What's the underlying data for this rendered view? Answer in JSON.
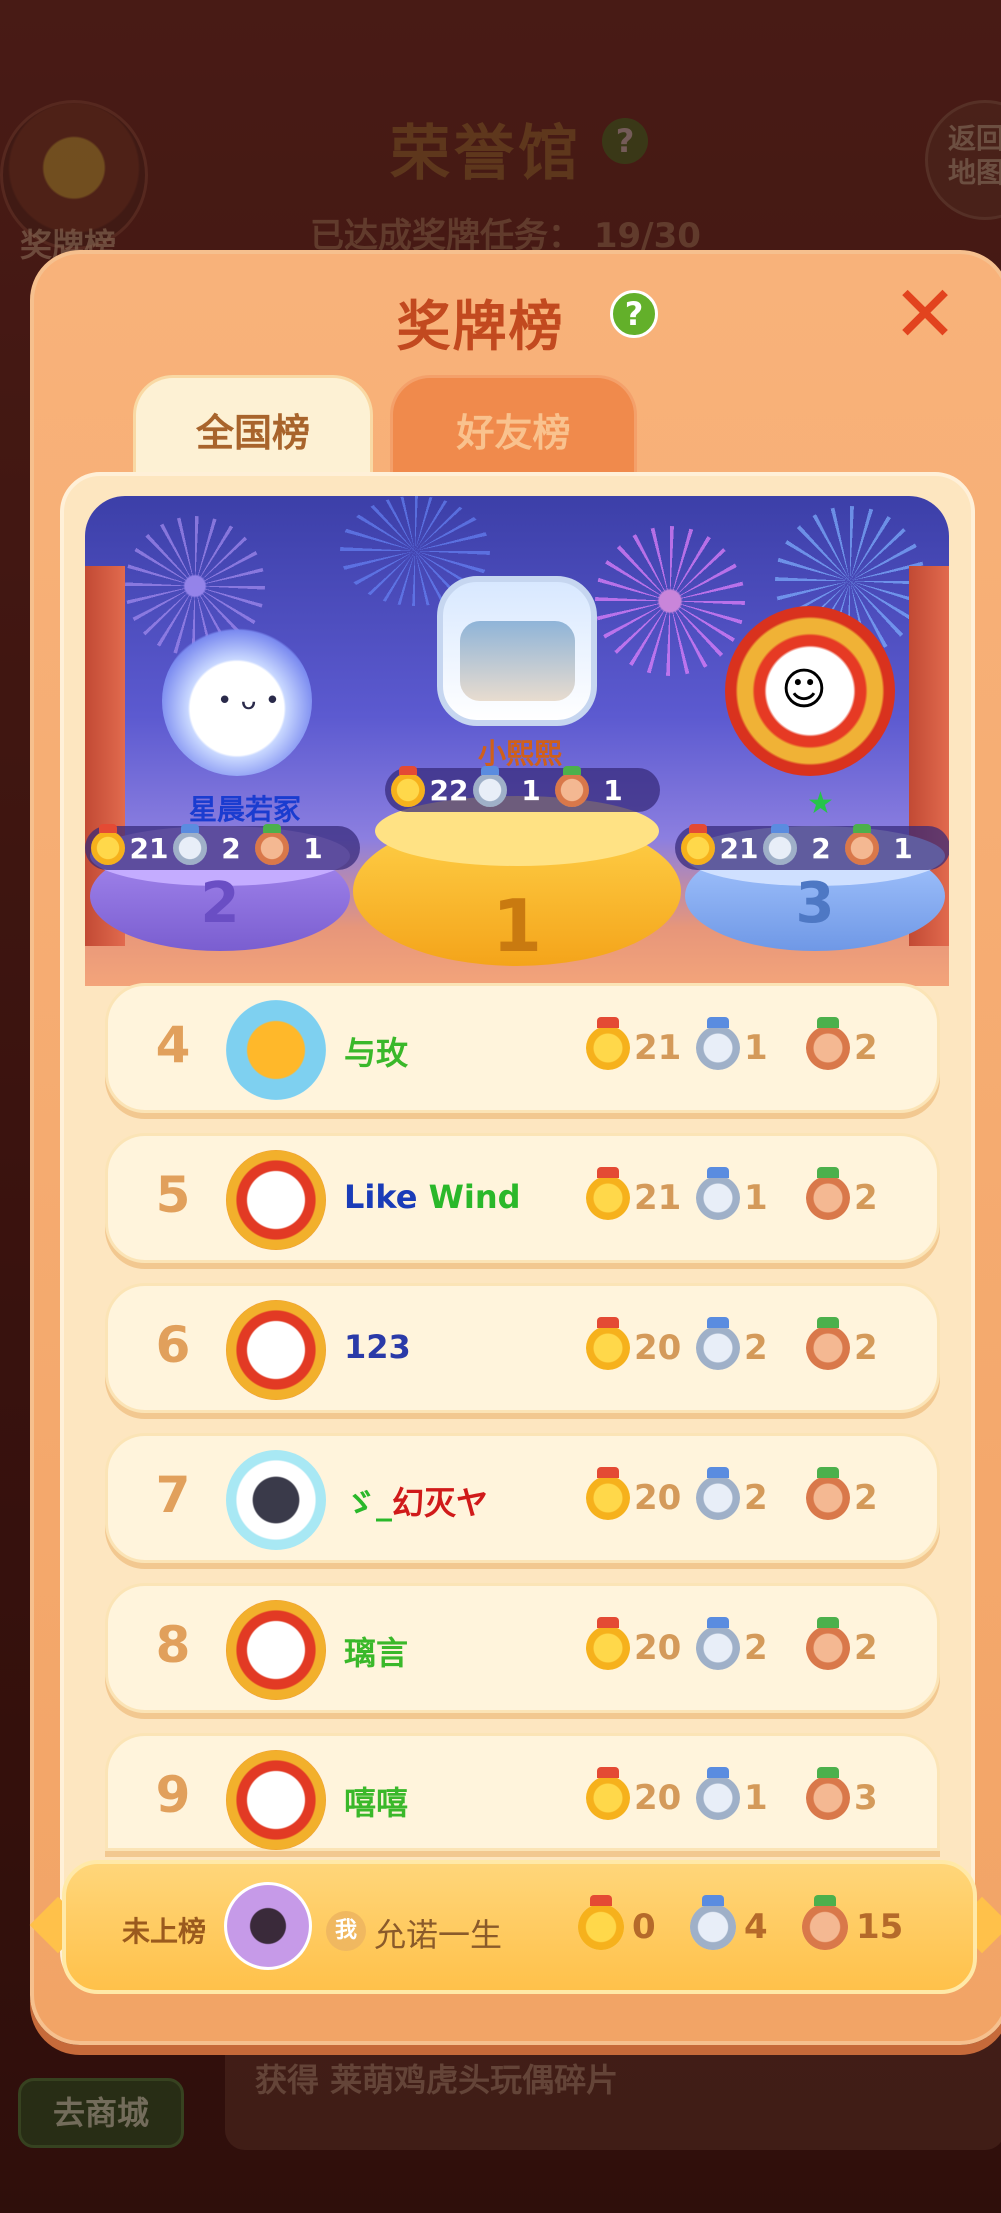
{
  "background": {
    "medal_board_label": "奖牌榜",
    "hall_title": "荣誉馆",
    "task_progress": "已达成奖牌任务： 19/30",
    "back_label": "返回地图",
    "shop_label": "去商城",
    "reward_text": "获得 莱萌鸡虎头玩偶碎片"
  },
  "panel": {
    "title": "奖牌榜",
    "help": "?",
    "close": "✕",
    "tabs": [
      "全国榜",
      "好友榜"
    ]
  },
  "podium": [
    {
      "rank": "2",
      "name": "星晨若冢",
      "gold": "21",
      "silver": "2",
      "bronze": "1"
    },
    {
      "rank": "1",
      "name": "小熙熙",
      "gold": "22",
      "silver": "1",
      "bronze": "1"
    },
    {
      "rank": "3",
      "name": "",
      "gold": "21",
      "silver": "2",
      "bronze": "1"
    }
  ],
  "rows": [
    {
      "rank": "4",
      "name": "与玫",
      "name_color": "#3ab82a",
      "gold": "21",
      "silver": "1",
      "bronze": "2"
    },
    {
      "rank": "5",
      "name_parts": [
        "Like",
        "Wind"
      ],
      "gold": "21",
      "silver": "1",
      "bronze": "2"
    },
    {
      "rank": "6",
      "name": "123",
      "name_color": "#2a3aa8",
      "gold": "20",
      "silver": "2",
      "bronze": "2"
    },
    {
      "rank": "7",
      "name_parts": [
        "ゞ_",
        "幻灭ヤ"
      ],
      "gold": "20",
      "silver": "2",
      "bronze": "2"
    },
    {
      "rank": "8",
      "name": "璃言",
      "name_color": "#3ab82a",
      "gold": "20",
      "silver": "2",
      "bronze": "2"
    },
    {
      "rank": "9",
      "name": "嘻嘻",
      "name_color": "#3ab82a",
      "gold": "20",
      "silver": "1",
      "bronze": "3"
    }
  ],
  "me": {
    "rank_label": "未上榜",
    "me_badge": "我",
    "name": "允诺一生",
    "gold": "0",
    "silver": "4",
    "bronze": "15"
  },
  "colors": {
    "panel": "#f2a466",
    "title": "#c2491f",
    "rank_text": "#e1a05c",
    "medal_count": "#d49a5a"
  }
}
